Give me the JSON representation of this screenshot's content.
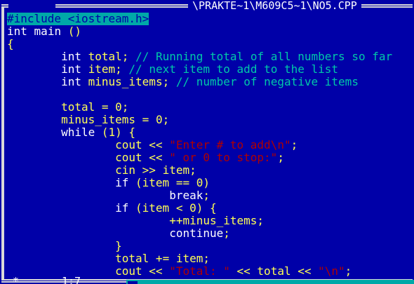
{
  "window": {
    "title": "\\PRAKTE~1\\M609C5~1\\NO5.CPP",
    "close_box": "[■]"
  },
  "status": {
    "star": "*",
    "cursor_position": "1:7"
  },
  "colors": {
    "background": "#0000a8",
    "preprocessor": "#00ffa0",
    "keyword": "#ffffff",
    "identifier": "#ffff55",
    "comment": "#00c8a8",
    "string": "#b00000",
    "selection": "#00a8a8"
  },
  "code": {
    "lines": [
      [
        {
          "t": "#include <iostream.h>",
          "k": "selected"
        }
      ],
      [
        {
          "t": "int",
          "k": "keyword"
        },
        {
          "t": " ",
          "k": "ws"
        },
        {
          "t": "main",
          "k": "keyword"
        },
        {
          "t": " ",
          "k": "ws"
        },
        {
          "t": "()",
          "k": "symbol"
        }
      ],
      [
        {
          "t": "{",
          "k": "symbol"
        }
      ],
      [
        {
          "t": "        ",
          "k": "ws"
        },
        {
          "t": "int",
          "k": "keyword"
        },
        {
          "t": " ",
          "k": "ws"
        },
        {
          "t": "total",
          "k": "ident"
        },
        {
          "t": ";",
          "k": "symbol"
        },
        {
          "t": " ",
          "k": "ws"
        },
        {
          "t": "// Running total of all numbers so far",
          "k": "comment"
        }
      ],
      [
        {
          "t": "        ",
          "k": "ws"
        },
        {
          "t": "int",
          "k": "keyword"
        },
        {
          "t": " ",
          "k": "ws"
        },
        {
          "t": "item",
          "k": "ident"
        },
        {
          "t": ";",
          "k": "symbol"
        },
        {
          "t": " ",
          "k": "ws"
        },
        {
          "t": "// next item to add to the list",
          "k": "comment"
        }
      ],
      [
        {
          "t": "        ",
          "k": "ws"
        },
        {
          "t": "int",
          "k": "keyword"
        },
        {
          "t": " ",
          "k": "ws"
        },
        {
          "t": "minus_items",
          "k": "ident"
        },
        {
          "t": ";",
          "k": "symbol"
        },
        {
          "t": " ",
          "k": "ws"
        },
        {
          "t": "// number of negative items",
          "k": "comment"
        }
      ],
      [],
      [
        {
          "t": "        ",
          "k": "ws"
        },
        {
          "t": "total",
          "k": "ident"
        },
        {
          "t": " = ",
          "k": "symbol"
        },
        {
          "t": "0",
          "k": "number"
        },
        {
          "t": ";",
          "k": "symbol"
        }
      ],
      [
        {
          "t": "        ",
          "k": "ws"
        },
        {
          "t": "minus_items",
          "k": "ident"
        },
        {
          "t": " = ",
          "k": "symbol"
        },
        {
          "t": "0",
          "k": "number"
        },
        {
          "t": ";",
          "k": "symbol"
        }
      ],
      [
        {
          "t": "        ",
          "k": "ws"
        },
        {
          "t": "while",
          "k": "keyword"
        },
        {
          "t": " ",
          "k": "ws"
        },
        {
          "t": "(1) {",
          "k": "symbol"
        }
      ],
      [
        {
          "t": "                ",
          "k": "ws"
        },
        {
          "t": "cout",
          "k": "ident"
        },
        {
          "t": " << ",
          "k": "symbol"
        },
        {
          "t": "\"Enter # to add\\n\"",
          "k": "string"
        },
        {
          "t": ";",
          "k": "symbol"
        }
      ],
      [
        {
          "t": "                ",
          "k": "ws"
        },
        {
          "t": "cout",
          "k": "ident"
        },
        {
          "t": " << ",
          "k": "symbol"
        },
        {
          "t": "\" or 0 to stop:\"",
          "k": "string"
        },
        {
          "t": ";",
          "k": "symbol"
        }
      ],
      [
        {
          "t": "                ",
          "k": "ws"
        },
        {
          "t": "cin",
          "k": "ident"
        },
        {
          "t": " >> ",
          "k": "symbol"
        },
        {
          "t": "item",
          "k": "ident"
        },
        {
          "t": ";",
          "k": "symbol"
        }
      ],
      [
        {
          "t": "                ",
          "k": "ws"
        },
        {
          "t": "if",
          "k": "keyword"
        },
        {
          "t": " (",
          "k": "symbol"
        },
        {
          "t": "item",
          "k": "ident"
        },
        {
          "t": " == ",
          "k": "symbol"
        },
        {
          "t": "0",
          "k": "number"
        },
        {
          "t": ")",
          "k": "symbol"
        }
      ],
      [
        {
          "t": "                        ",
          "k": "ws"
        },
        {
          "t": "break",
          "k": "keyword"
        },
        {
          "t": ";",
          "k": "symbol"
        }
      ],
      [
        {
          "t": "                ",
          "k": "ws"
        },
        {
          "t": "if",
          "k": "keyword"
        },
        {
          "t": " (",
          "k": "symbol"
        },
        {
          "t": "item",
          "k": "ident"
        },
        {
          "t": " < ",
          "k": "symbol"
        },
        {
          "t": "0",
          "k": "number"
        },
        {
          "t": ") {",
          "k": "symbol"
        }
      ],
      [
        {
          "t": "                        ",
          "k": "ws"
        },
        {
          "t": "++",
          "k": "symbol"
        },
        {
          "t": "minus_items",
          "k": "ident"
        },
        {
          "t": ";",
          "k": "symbol"
        }
      ],
      [
        {
          "t": "                        ",
          "k": "ws"
        },
        {
          "t": "continue",
          "k": "keyword"
        },
        {
          "t": ";",
          "k": "symbol"
        }
      ],
      [
        {
          "t": "                ",
          "k": "ws"
        },
        {
          "t": "}",
          "k": "symbol"
        }
      ],
      [
        {
          "t": "                ",
          "k": "ws"
        },
        {
          "t": "total",
          "k": "ident"
        },
        {
          "t": " += ",
          "k": "symbol"
        },
        {
          "t": "item",
          "k": "ident"
        },
        {
          "t": ";",
          "k": "symbol"
        }
      ],
      [
        {
          "t": "                ",
          "k": "ws"
        },
        {
          "t": "cout",
          "k": "ident"
        },
        {
          "t": " << ",
          "k": "symbol"
        },
        {
          "t": "\"Total: \"",
          "k": "string"
        },
        {
          "t": " << ",
          "k": "symbol"
        },
        {
          "t": "total",
          "k": "ident"
        },
        {
          "t": " << ",
          "k": "symbol"
        },
        {
          "t": "\"\\n\"",
          "k": "string"
        },
        {
          "t": ";",
          "k": "symbol"
        }
      ]
    ]
  }
}
